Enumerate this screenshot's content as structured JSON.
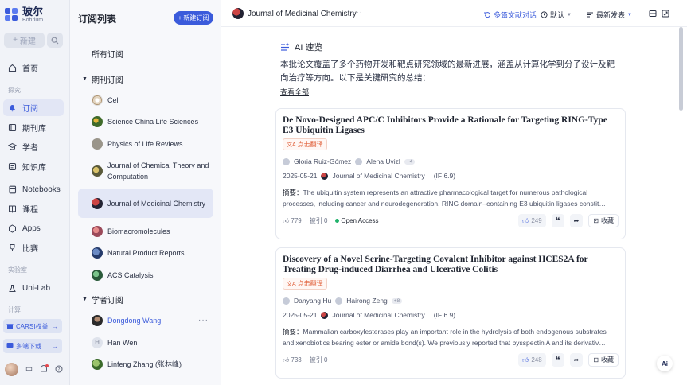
{
  "app": {
    "name": "玻尔",
    "sub": "Bohrium",
    "new_label": "新建"
  },
  "rail": {
    "home": "首页",
    "section_explore": "探究",
    "subscribe": "订阅",
    "journals": "期刊库",
    "scholars": "学者",
    "knowledge": "知识库",
    "notebooks": "Notebooks",
    "courses": "课程",
    "apps": "Apps",
    "contest": "比赛",
    "section_lab": "实验室",
    "unilab": "Uni-Lab",
    "section_compute": "计算",
    "promo1": "CARSI权益",
    "promo2": "多端下载",
    "lang": "中"
  },
  "subs": {
    "title": "订阅列表",
    "new_label": "新建订阅",
    "all": "所有订阅",
    "group_journal": "期刊订阅",
    "journals": [
      "Cell",
      "Science China Life Sciences",
      "Physics of Life Reviews",
      "Journal of Chemical Theory and Computation",
      "Journal of Medicinal Chemistry",
      "Biomacromolecules",
      "Natural Product Reports",
      "ACS Catalysis"
    ],
    "group_scholar": "学者订阅",
    "scholars": [
      "Dongdong Wang",
      "Han Wen",
      "Linfeng Zhang (张林峰)"
    ],
    "scholar_initial": "H"
  },
  "main": {
    "journal": "Journal of Medicinal Chemistry",
    "multi_chat": "多篇文献对话",
    "default_label": "默认",
    "sort_label": "最新发表",
    "ai_title": "AI 速览",
    "summary": "本批论文覆盖了多个药物开发和靶点研究领域的最新进展，涵盖从计算化学到分子设计及靶向治疗等方向。以下是关键研究的总结：",
    "see_all": "查看全部",
    "translate": "点击翻译",
    "open_access": "Open Access",
    "save": "收藏",
    "ai_badge": "Ai"
  },
  "papers": [
    {
      "title": "De Novo-Designed APC/C Inhibitors Provide a Rationale for Targeting RING-Type E3 Ubiquitin Ligases",
      "author1": "Gloria Ruiz-Gómez",
      "author2": "Alena Uvizl",
      "more": "+4",
      "date": "2025-05-21",
      "journal": "Journal of Medicinal Chemistry",
      "if": "(IF 6.9)",
      "abstract_label": "摘要：",
      "abstract": "The ubiquitin system represents an attractive pharmacological target for numerous pathological processes, including cancer and neurodegeneration. RING domain–containing E3 ubiquitin ligases constit…",
      "views": "779",
      "cited": "被引 0",
      "likes": "249"
    },
    {
      "title": "Discovery of a Novel Serine-Targeting Covalent Inhibitor against HCES2A for Treating Drug-induced Diarrhea and Ulcerative Colitis",
      "author1": "Danyang Hu",
      "author2": "Hairong Zeng",
      "more": "+8",
      "date": "2025-05-21",
      "journal": "Journal of Medicinal Chemistry",
      "if": "(IF 6.9)",
      "abstract_label": "摘要：",
      "abstract": "Mammalian carboxylesterases play an important role in the hydrolysis of both endogenous substrates and xenobiotics bearing ester or amide bond(s). We previously reported that bysspectin A and its derivativ…",
      "views": "733",
      "cited": "被引 0",
      "likes": "248"
    }
  ],
  "colors": {
    "accent": "#3b5bdb",
    "open_access": "#20b26b",
    "translate": "#e0603a"
  }
}
